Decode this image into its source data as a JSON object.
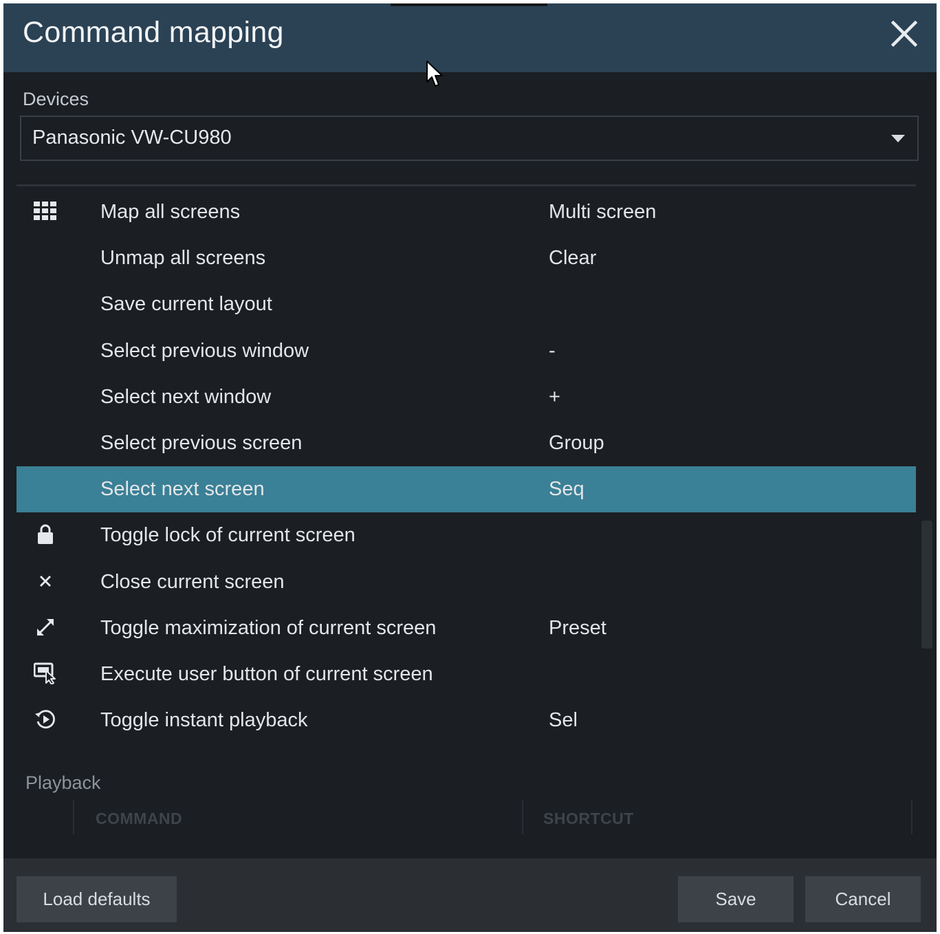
{
  "window": {
    "title": "Command mapping",
    "close_icon": "close-icon"
  },
  "devices": {
    "label": "Devices",
    "selected": "Panasonic VW-CU980"
  },
  "commands": [
    {
      "icon": "grid-icon",
      "command": "Map all screens",
      "shortcut": "Multi screen"
    },
    {
      "icon": "",
      "command": "Unmap all screens",
      "shortcut": "Clear"
    },
    {
      "icon": "",
      "command": "Save current layout",
      "shortcut": ""
    },
    {
      "icon": "",
      "command": "Select previous window",
      "shortcut": "-"
    },
    {
      "icon": "",
      "command": "Select next window",
      "shortcut": "+"
    },
    {
      "icon": "",
      "command": "Select previous screen",
      "shortcut": "Group"
    },
    {
      "icon": "",
      "command": "Select next screen",
      "shortcut": "Seq",
      "selected": true
    },
    {
      "icon": "lock-icon",
      "command": "Toggle lock of current screen",
      "shortcut": ""
    },
    {
      "icon": "close-small-icon",
      "command": "Close current screen",
      "shortcut": ""
    },
    {
      "icon": "maximize-icon",
      "command": "Toggle maximization of current screen",
      "shortcut": "Preset"
    },
    {
      "icon": "user-button-icon",
      "command": "Execute user button of current screen",
      "shortcut": ""
    },
    {
      "icon": "instant-playback-icon",
      "command": "Toggle instant playback",
      "shortcut": "Sel"
    }
  ],
  "playback_section": {
    "label": "Playback",
    "columns": [
      "COMMAND",
      "SHORTCUT"
    ]
  },
  "footer": {
    "load_defaults": "Load defaults",
    "save": "Save",
    "cancel": "Cancel"
  },
  "colors": {
    "titlebar": "#2b4255",
    "background": "#1b1e22",
    "selected_row": "#3a8096",
    "footer": "#2b2f34"
  }
}
